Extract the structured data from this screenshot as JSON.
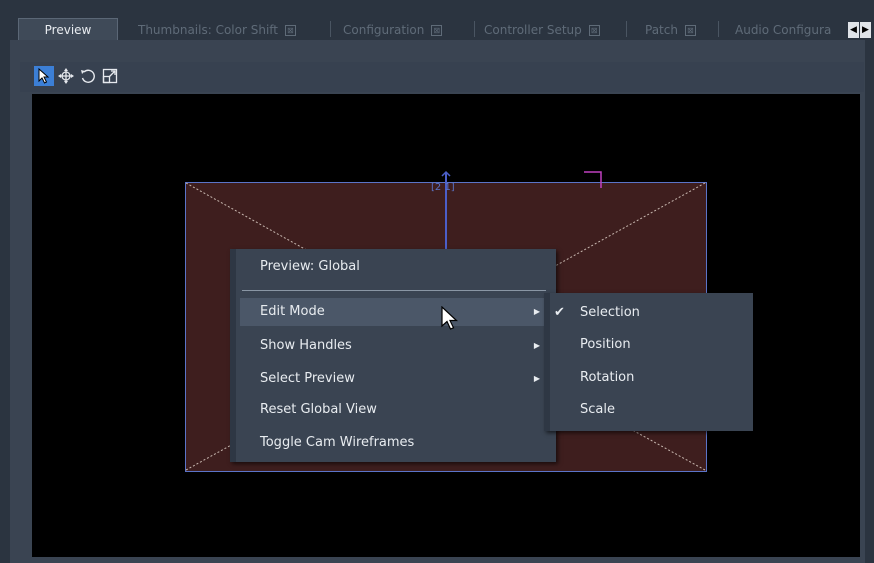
{
  "tabs": [
    {
      "label": "Preview",
      "active": true
    },
    {
      "label": "Thumbnails: Color Shift",
      "closable": true
    },
    {
      "label": "Configuration",
      "closable": true
    },
    {
      "label": "Controller Setup",
      "closable": true
    },
    {
      "label": "Patch",
      "closable": true
    },
    {
      "label": "Audio Configura",
      "closable": false
    }
  ],
  "tab_close_glyph": "⊠",
  "scroll": {
    "left_icon": "◀",
    "right_icon": "▶"
  },
  "toolbar": {
    "tools": [
      {
        "name": "select-tool",
        "icon": "arrow-cursor-icon",
        "active": true
      },
      {
        "name": "move-tool",
        "icon": "move-icon"
      },
      {
        "name": "rotate-tool",
        "icon": "rotate-icon"
      },
      {
        "name": "scale-tool",
        "icon": "scale-icon"
      }
    ]
  },
  "viewport": {
    "object_label": "[2 1]"
  },
  "context_menu": {
    "title": "Preview: Global",
    "items": [
      {
        "label": "Edit Mode",
        "has_submenu": true,
        "highlighted": true
      },
      {
        "label": "Show Handles",
        "has_submenu": true
      },
      {
        "label": "Select Preview",
        "has_submenu": true
      },
      {
        "label": "Reset Global View"
      },
      {
        "label": "Toggle Cam Wireframes"
      }
    ]
  },
  "submenu": {
    "items": [
      {
        "label": "Selection",
        "checked": true
      },
      {
        "label": "Position"
      },
      {
        "label": "Rotation"
      },
      {
        "label": "Scale"
      }
    ],
    "check_glyph": "✔"
  },
  "colors": {
    "accent": "#3c7fd6",
    "plane_fill": "#3e1e1e",
    "plane_outline": "#5b74c8",
    "handle_magenta": "#c040c0"
  }
}
